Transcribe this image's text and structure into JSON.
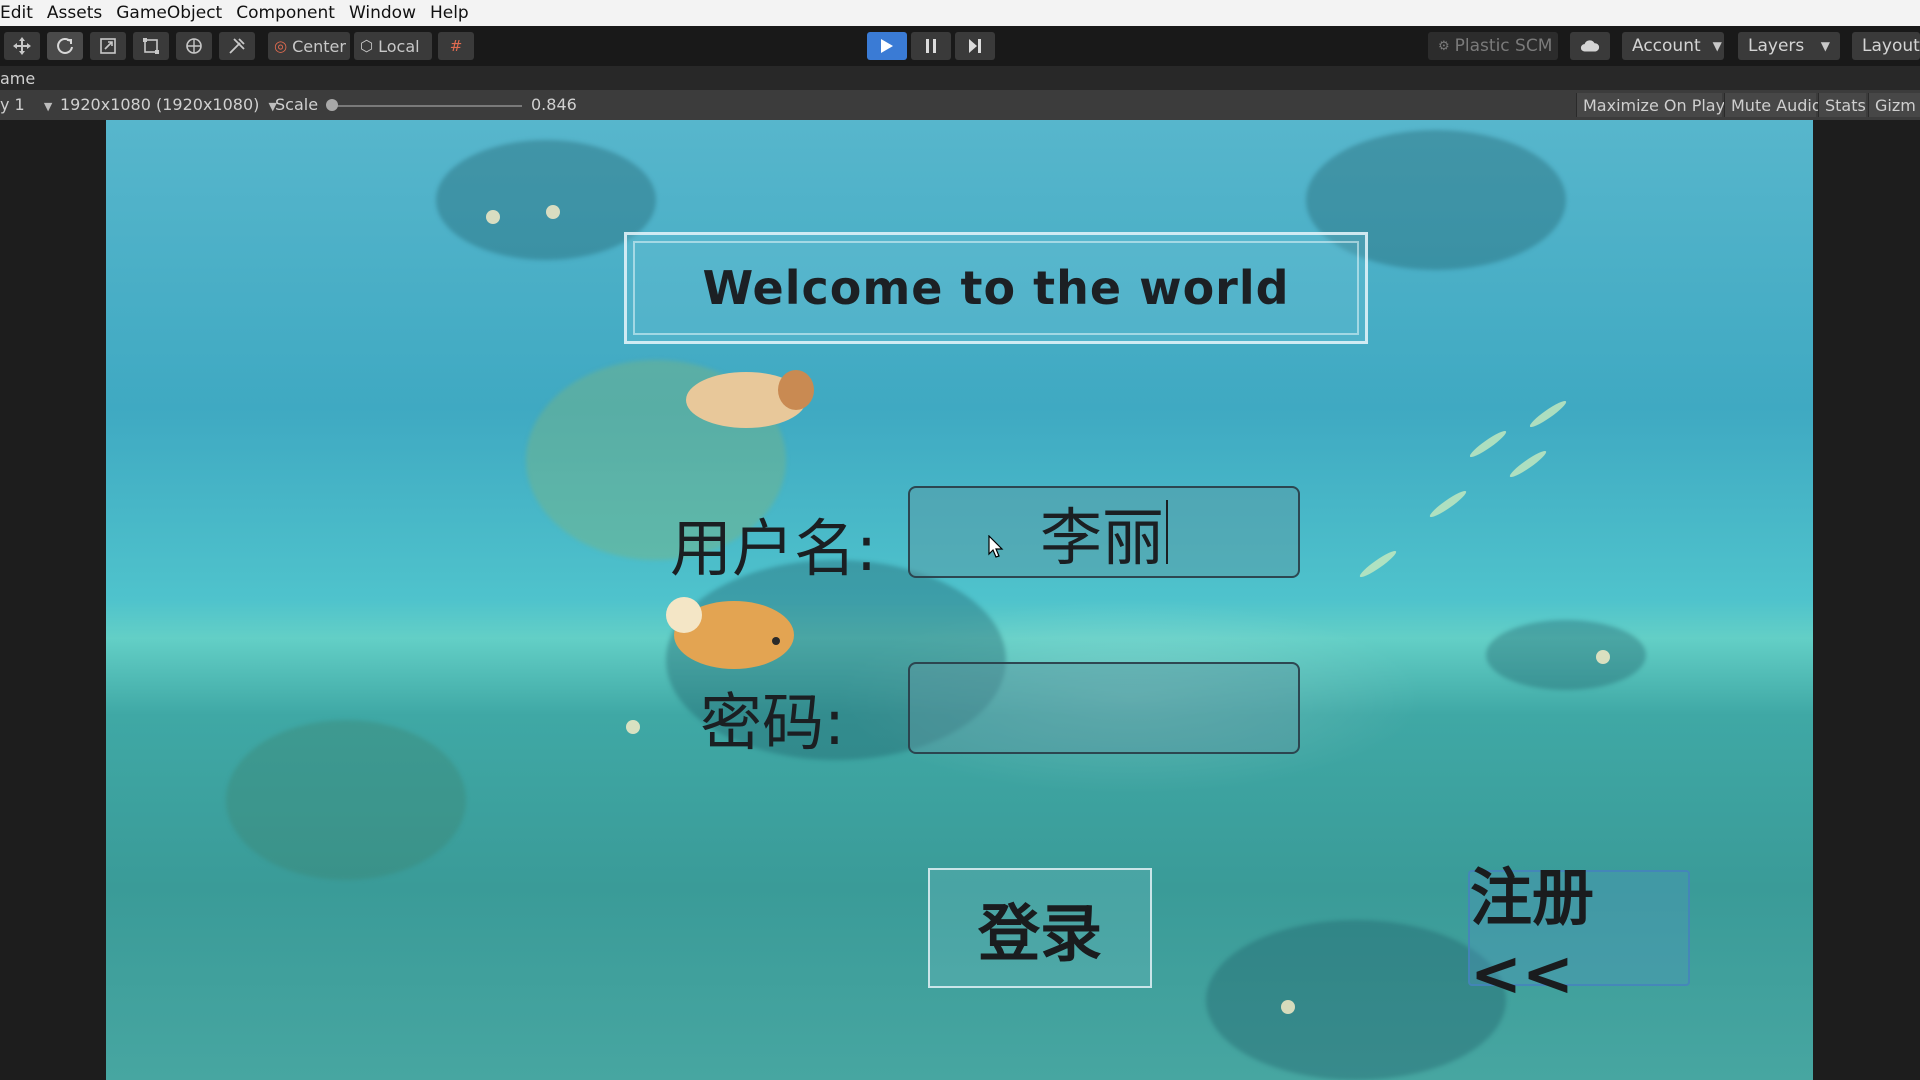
{
  "menu": {
    "items": [
      "Edit",
      "Assets",
      "GameObject",
      "Component",
      "Window",
      "Help"
    ]
  },
  "toolbar": {
    "tools": [
      "move-tool-icon",
      "rotate-tool-icon",
      "scale-tool-icon",
      "rect-tool-icon",
      "transform-tool-icon",
      "custom-tool-icon"
    ],
    "pivot_label": "Center",
    "space_label": "Local",
    "plastic_label": "Plastic SCM",
    "account_label": "Account",
    "layers_label": "Layers",
    "layout_label": "Layout",
    "play_state": "playing"
  },
  "tab": {
    "title": "ame"
  },
  "game_bar": {
    "display": "y 1",
    "resolution": "1920x1080 (1920x1080)",
    "scale_label": "Scale",
    "scale_value": "0.846",
    "scale_fraction": 0.0,
    "maximize_label": "Maximize On Play",
    "mute_label": "Mute Audio",
    "stats_label": "Stats",
    "gizmos_label": "Gizm"
  },
  "game": {
    "title": "Welcome to the world",
    "username_label": "用户名:",
    "username_value": "李丽",
    "password_label": "密码:",
    "password_value": "",
    "login_label": "登录",
    "register_label": "注册<<"
  },
  "colors": {
    "play_active": "#3a7bd5",
    "editor_bg": "#1e1e1e",
    "water": "#45afc3"
  }
}
